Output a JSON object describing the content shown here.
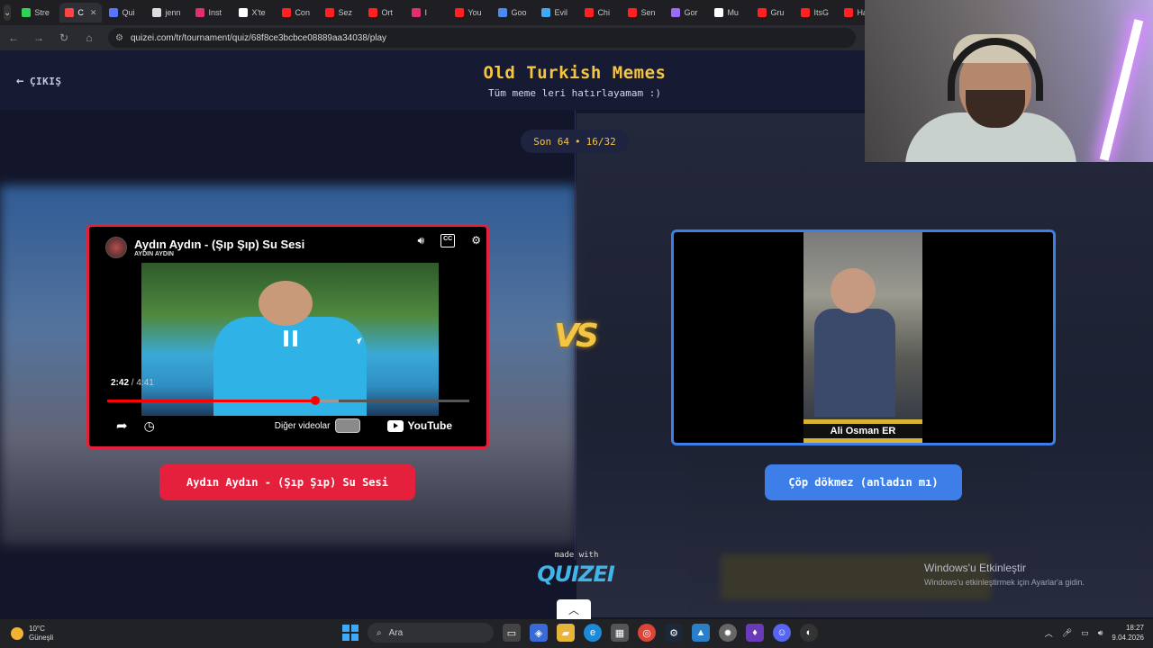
{
  "browser": {
    "tabs": [
      {
        "label": "Stre",
        "color": "#31d158"
      },
      {
        "label": "C",
        "color": "#ff4444",
        "active": true
      },
      {
        "label": "Qui",
        "color": "#5577ff"
      },
      {
        "label": "jenn",
        "color": "#dddddd"
      },
      {
        "label": "Inst",
        "color": "#e1306c"
      },
      {
        "label": "X'te",
        "color": "#ffffff"
      },
      {
        "label": "Con",
        "color": "#ff2020"
      },
      {
        "label": "Sez",
        "color": "#ff2020"
      },
      {
        "label": "Ort",
        "color": "#ff2020"
      },
      {
        "label": "I",
        "color": "#e1306c"
      },
      {
        "label": "You",
        "color": "#ff2020"
      },
      {
        "label": "Goo",
        "color": "#4a8af4"
      },
      {
        "label": "Evil",
        "color": "#3fa9f5"
      },
      {
        "label": "Chi",
        "color": "#ff2020"
      },
      {
        "label": "Sen",
        "color": "#ff2020"
      },
      {
        "label": "Gor",
        "color": "#9b6bff"
      },
      {
        "label": "Mu",
        "color": "#ffffff"
      },
      {
        "label": "Gru",
        "color": "#ff2020"
      },
      {
        "label": "ItsG",
        "color": "#ff2020"
      },
      {
        "label": "Han",
        "color": "#ff2020"
      }
    ],
    "url": "quizei.com/tr/tournament/quiz/68f8ce3bcbce08889aa34038/play"
  },
  "page": {
    "exit_label": "ÇIKIŞ",
    "title": "Old Turkish Memes",
    "subtitle": "Tüm meme leri hatırlayamam :)",
    "round_label": "Son 64",
    "round_sep": "•",
    "round_progress": "16/32"
  },
  "left": {
    "video_title": "Aydın Aydın - (Şıp Şıp) Su Sesi",
    "channel": "AYDIN AYDIN",
    "time_current": "2:42",
    "time_total": "4:41",
    "progress": 0.575,
    "buffered": 0.64,
    "more_videos": "Diğer videolar",
    "yt_brand": "YouTube",
    "choice_label": "Aydın Aydın - (Şıp Şıp) Su Sesi",
    "accent": "#e5203c"
  },
  "right": {
    "caption": "Ali Osman ER",
    "choice_label": "Çöp dökmez (anladın mı)",
    "accent": "#3d7ee8"
  },
  "vs_label": "VS",
  "footer": {
    "made_with": "made with",
    "brand": "QUIZEI"
  },
  "windows_activation": {
    "line1": "Windows'u Etkinleştir",
    "line2": "Windows'u etkinleştirmek için Ayarlar'a gidin."
  },
  "taskbar": {
    "temp": "10°C",
    "weather": "Güneşli",
    "search": "Ara",
    "time": "18:27",
    "date": "9.04.2026"
  }
}
